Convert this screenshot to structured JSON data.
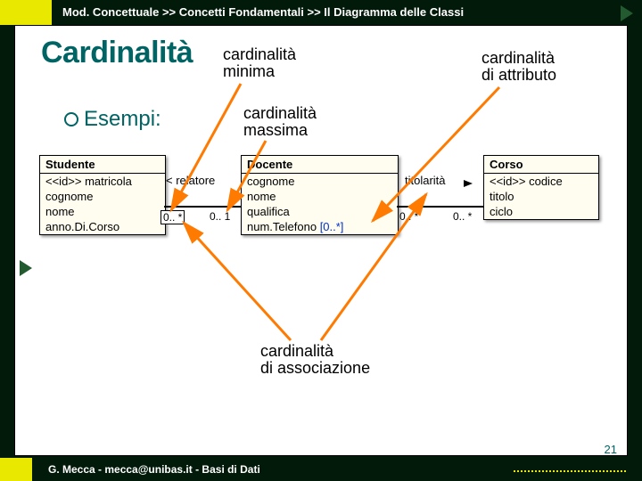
{
  "breadcrumb": "Mod. Concettuale >> Concetti Fondamentali >> Il Diagramma delle Classi",
  "title": "Cardinalità",
  "labels": {
    "min": "cardinalità\nminima",
    "max": "cardinalità\nmassima",
    "attr": "cardinalità\ndi attributo",
    "assoc": "cardinalità\ndi associazione"
  },
  "esempi": "Esempi:",
  "classes": {
    "studente": {
      "name": "Studente",
      "attrs": [
        "<<id>> matricola",
        "cognome",
        "nome",
        "anno.Di.Corso"
      ]
    },
    "docente": {
      "name": "Docente",
      "attrs": [
        "cognome",
        "nome",
        "qualifica"
      ],
      "lastAttr": "num.Telefono",
      "lastMult": "[0..*]"
    },
    "corso": {
      "name": "Corso",
      "attrs": [
        "<<id>> codice",
        "titolo",
        "ciclo"
      ]
    }
  },
  "assoc": {
    "relatore": "< relatore",
    "titolarita": "titolarità",
    "m_stu": "0.. *",
    "m_doc_l": "0.. 1",
    "m_doc_r": "0.. *",
    "m_cor": "0.. *"
  },
  "footer": "G. Mecca - mecca@unibas.it - Basi di Dati",
  "pagenum": "21"
}
